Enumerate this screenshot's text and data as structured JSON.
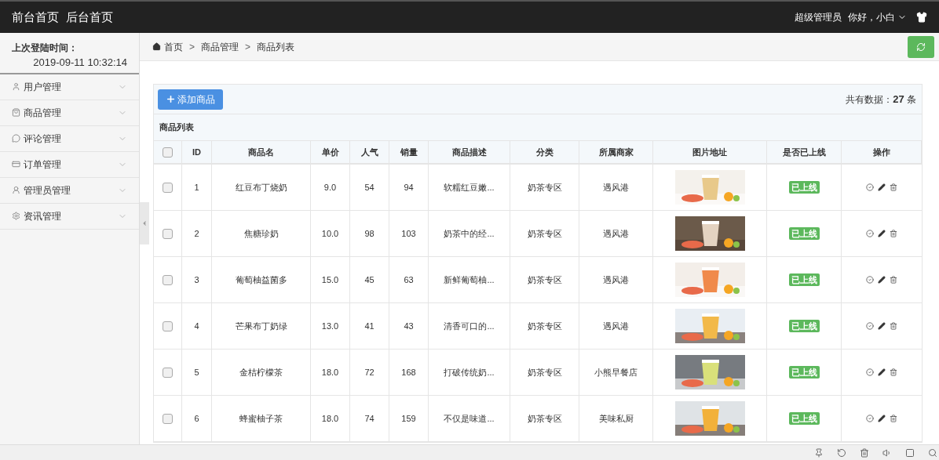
{
  "top_bar": {
    "links": [
      "前台首页",
      "后台首页"
    ],
    "role": "超级管理员",
    "greeting": "你好，小白"
  },
  "sidebar": {
    "last_login_label": "上次登陆时间：",
    "last_login_time": "2019-09-11 10:32:14",
    "items": [
      {
        "label": "用户管理",
        "kind": "user"
      },
      {
        "label": "商品管理",
        "kind": "bag"
      },
      {
        "label": "评论管理",
        "kind": "comment"
      },
      {
        "label": "订单管理",
        "kind": "card"
      },
      {
        "label": "管理员管理",
        "kind": "admin"
      },
      {
        "label": "资讯管理",
        "kind": "gear"
      }
    ]
  },
  "breadcrumb": {
    "separator": ">",
    "items": [
      "首页",
      "商品管理",
      "商品列表"
    ]
  },
  "toolbar": {
    "add_button": "添加商品",
    "total_label": "共有数据：",
    "total_count": "27",
    "total_unit": "条"
  },
  "table": {
    "title": "商品列表",
    "header_checked": false,
    "columns": [
      "ID",
      "商品名",
      "单价",
      "人气",
      "销量",
      "商品描述",
      "分类",
      "所属商家",
      "图片地址",
      "是否已上线",
      "操作"
    ],
    "rows": [
      {
        "checked": false,
        "id": "1",
        "name": "红豆布丁烧奶",
        "price": "9.0",
        "popularity": "54",
        "sales": "94",
        "description": "软糯红豆嫩...",
        "category": "奶茶专区",
        "merchant": "遇风港",
        "status": "已上线"
      },
      {
        "checked": false,
        "id": "2",
        "name": "焦糖珍奶",
        "price": "10.0",
        "popularity": "98",
        "sales": "103",
        "description": "奶茶中的经...",
        "category": "奶茶专区",
        "merchant": "遇风港",
        "status": "已上线"
      },
      {
        "checked": false,
        "id": "3",
        "name": "葡萄柚益菌多",
        "price": "15.0",
        "popularity": "45",
        "sales": "63",
        "description": "新鲜葡萄柚...",
        "category": "奶茶专区",
        "merchant": "遇风港",
        "status": "已上线"
      },
      {
        "checked": false,
        "id": "4",
        "name": "芒果布丁奶绿",
        "price": "13.0",
        "popularity": "41",
        "sales": "43",
        "description": "清香可口的...",
        "category": "奶茶专区",
        "merchant": "遇风港",
        "status": "已上线"
      },
      {
        "checked": false,
        "id": "5",
        "name": "金桔柠檬茶",
        "price": "18.0",
        "popularity": "72",
        "sales": "168",
        "description": "打破传统奶...",
        "category": "奶茶专区",
        "merchant": "小熊早餐店",
        "status": "已上线"
      },
      {
        "checked": false,
        "id": "6",
        "name": "蜂蜜柚子茶",
        "price": "18.0",
        "popularity": "74",
        "sales": "159",
        "description": "不仅是味道...",
        "category": "奶茶专区",
        "merchant": "美味私厨",
        "status": "已上线"
      }
    ]
  }
}
